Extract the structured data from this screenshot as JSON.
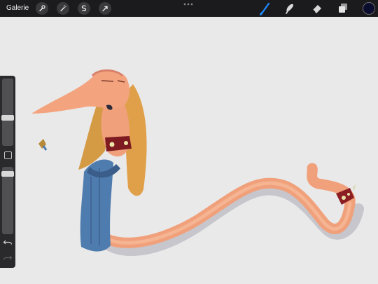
{
  "toolbar": {
    "gallery_label": "Galerie",
    "left_tools": [
      "wrench-icon",
      "magic-wand-icon",
      "selection-icon",
      "transform-icon"
    ],
    "right_tools": [
      "brush-icon",
      "smudge-icon",
      "eraser-icon",
      "layers-icon"
    ],
    "active_tool": "brush-icon",
    "current_color": "#0b0d2e",
    "accent_color": "#1f8bff"
  },
  "sidebar": {
    "brush_size_level": 0.22,
    "opacity_level": 0.06,
    "buttons": [
      "modify-button",
      "undo-icon",
      "redo-icon"
    ]
  },
  "canvas": {
    "background": "#e9e9e9",
    "subject": "snake-character-illustration"
  }
}
